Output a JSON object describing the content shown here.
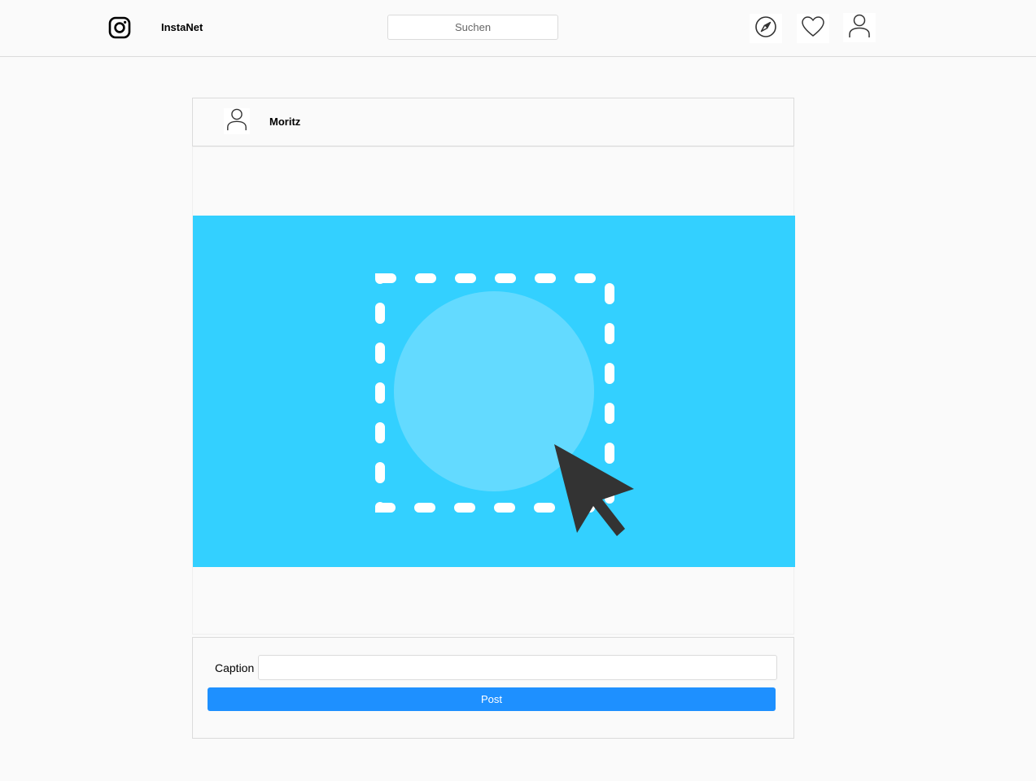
{
  "header": {
    "logo_icon": "instagram-camera-icon",
    "brand": "InstaNet",
    "search": {
      "placeholder": "Suchen",
      "value": ""
    },
    "nav": [
      {
        "icon": "compass-icon"
      },
      {
        "icon": "heart-icon"
      },
      {
        "icon": "user-icon"
      }
    ]
  },
  "post": {
    "avatar_icon": "user-icon",
    "username": "Moritz",
    "upload": {
      "icon": "upload-drop-zone-icon",
      "background_color": "#33d0ff",
      "circle_color": "#63daff",
      "cursor_color": "#333333"
    }
  },
  "form": {
    "caption_label": "Caption",
    "caption_value": "",
    "post_button_label": "Post",
    "post_button_color": "#1e90ff"
  }
}
